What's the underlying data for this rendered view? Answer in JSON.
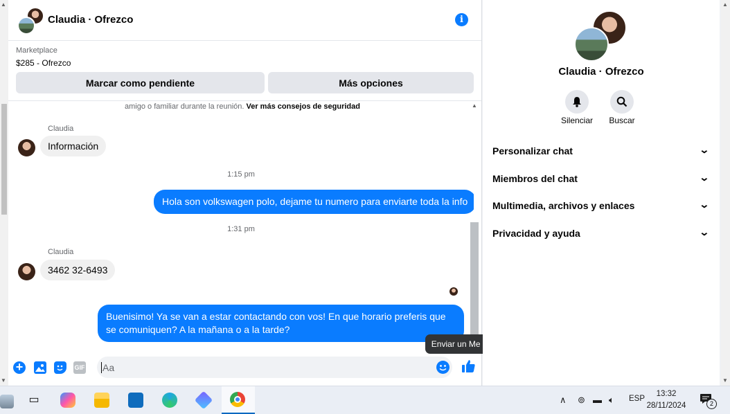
{
  "chat": {
    "title": "Claudia · Ofrezco",
    "marketplace_label": "Marketplace",
    "listing": "$285 - Ofrezco",
    "mark_pending_label": "Marcar como pendiente",
    "more_options_label": "Más opciones",
    "safety_text": "amigo o familiar durante la reunión.",
    "safety_link": "Ver más consejos de seguridad",
    "messages": [
      {
        "sender": "Claudia",
        "text": "Información"
      },
      {
        "time": "1:15 pm"
      },
      {
        "text": "Hola son volkswagen polo, dejame tu numero para enviarte toda la info"
      },
      {
        "time": "1:31 pm"
      },
      {
        "sender": "Claudia",
        "text": "3462 32-6493"
      },
      {
        "text": "Buenisimo! Ya se van a estar contactando con vos! En que horario preferis que se comuniquen? A la mañana o a la tarde?"
      }
    ],
    "composer_placeholder": "Aa",
    "gif_label": "GIF",
    "like_tooltip": "Enviar un Me gusta"
  },
  "side": {
    "title": "Claudia · Ofrezco",
    "mute_label": "Silenciar",
    "search_label": "Buscar",
    "sections": [
      "Personalizar chat",
      "Miembros del chat",
      "Multimedia, archivos y enlaces",
      "Privacidad y ayuda"
    ]
  },
  "taskbar": {
    "language": "ESP",
    "time": "13:32",
    "date": "28/11/2024",
    "notification_count": "2"
  },
  "colors": {
    "accent": "#0a7cff",
    "bubble_in": "#f0f0f0"
  }
}
